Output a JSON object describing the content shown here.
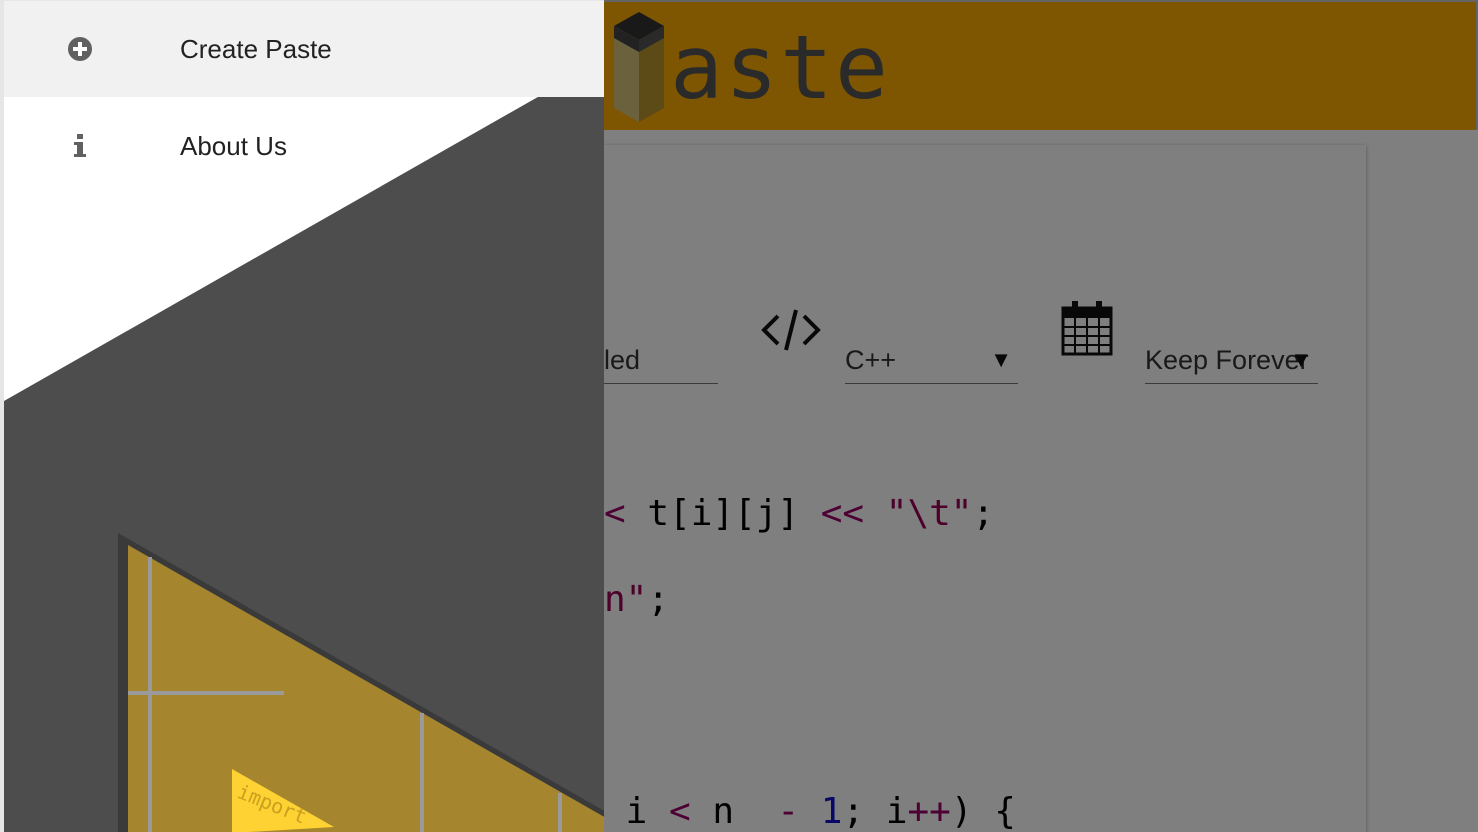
{
  "header": {
    "logo_text": "aste"
  },
  "form": {
    "title_value_partial": "led",
    "language": {
      "selected": "C++"
    },
    "expiration": {
      "selected": "Keep Forever"
    }
  },
  "code": {
    "line1": {
      "op1": "< ",
      "expr": "t[i][j] ",
      "op2": "<< ",
      "str": "\"\\t\"",
      "end": ";"
    },
    "line2": {
      "str": "n\"",
      "end": ";"
    },
    "line3": {
      "pre": " i ",
      "op": "< ",
      "var": "n ",
      "minus": " - ",
      "num": "1",
      "post": "; i",
      "inc": "++",
      "tail": ") {"
    }
  },
  "drawer": {
    "items": [
      {
        "label": "Create Paste",
        "icon": "plus-circle-icon"
      },
      {
        "label": "About Us",
        "icon": "info-icon"
      }
    ],
    "art_code_text": "import"
  },
  "colors": {
    "brand": "#fdab00",
    "drawer_dark": "#4d4d4d",
    "scrim": "rgba(0,0,0,0.5)"
  }
}
